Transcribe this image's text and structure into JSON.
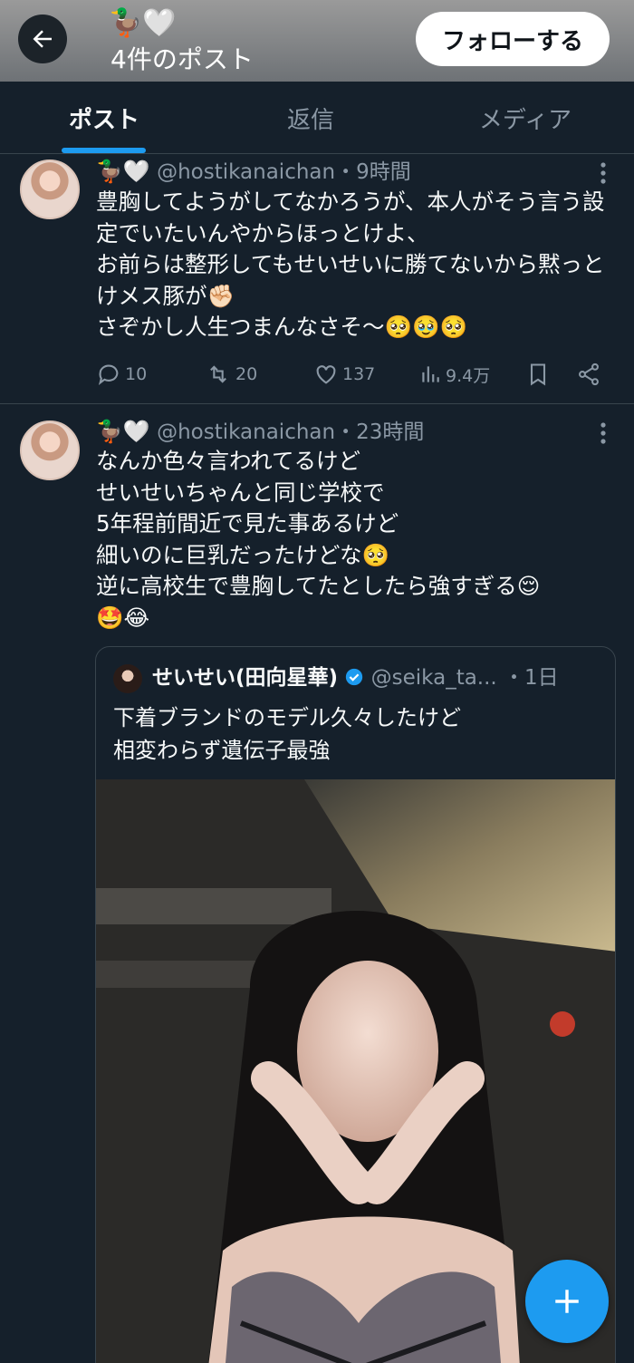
{
  "header": {
    "name": "🦆🤍",
    "post_count": "4件のポスト",
    "follow_label": "フォローする"
  },
  "tabs": [
    {
      "label": "ポスト",
      "active": true
    },
    {
      "label": "返信",
      "active": false
    },
    {
      "label": "メディア",
      "active": false
    }
  ],
  "posts": [
    {
      "display_name": "🦆🤍",
      "handle": "@hostikanaichan",
      "time": "・9時間",
      "text": "豊胸してようがしてなかろうが、本人がそう言う設定でいたいんやからほっとけよ、\nお前らは整形してもせいせいに勝てないから黙っとけメス豚が✊🏻\nさぞかし人生つまんなさそ〜🥺🥹🥺",
      "replies": "10",
      "reposts": "20",
      "likes": "137",
      "views": "9.4万"
    },
    {
      "display_name": "🦆🤍",
      "handle": "@hostikanaichan",
      "time": "・23時間",
      "text": "なんか色々言われてるけど\nせいせいちゃんと同じ学校で\n5年程前間近で見た事あるけど\n細いのに巨乳だったけどな🥺\n逆に高校生で豊胸してたとしたら強すぎる😌\n🤩😂",
      "quote": {
        "display_name": "せいせい(田向星華)",
        "handle": "@seika_ta...",
        "time": "・1日",
        "text": "下着ブランドのモデル久々したけど\n相変わらず遺伝子最強"
      }
    }
  ],
  "colors": {
    "background": "#15202b",
    "accent": "#1d9bf0",
    "muted": "#8b98a5",
    "divider": "#38444d"
  },
  "icons": [
    "back-arrow-icon",
    "more-icon",
    "reply-icon",
    "repost-icon",
    "like-icon",
    "views-icon",
    "bookmark-icon",
    "share-icon",
    "verified-badge-icon",
    "compose-plus-icon"
  ]
}
